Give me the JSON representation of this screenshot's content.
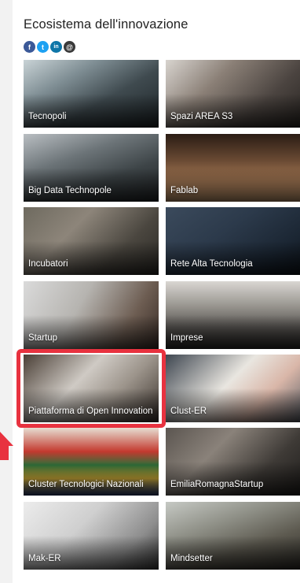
{
  "section": {
    "title": "Ecosistema dell'innovazione"
  },
  "social": [
    {
      "icon": "facebook-icon",
      "color": "#3b5998",
      "glyph": "f"
    },
    {
      "icon": "twitter-icon",
      "color": "#1da1f2",
      "glyph": "t"
    },
    {
      "icon": "linkedin-icon",
      "color": "#0e76a8",
      "glyph": "in"
    },
    {
      "icon": "email-icon",
      "color": "#3a3a3a",
      "glyph": "@"
    }
  ],
  "highlight_color": "#e8323f",
  "tiles": [
    {
      "label": "Tecnopoli",
      "name": "tile-tecnopoli",
      "bg": "linear-gradient(150deg,#c9d3d6 0%,#7f8e94 30%,#3f4a4f 60%,#1e2528 100%)"
    },
    {
      "label": "Spazi AREA S3",
      "name": "tile-spazi-area-s3",
      "bg": "linear-gradient(135deg,#d8d4cf 0%,#8a7f76 35%,#4b4440 70%,#2a2623 100%)"
    },
    {
      "label": "Big Data Technopole",
      "name": "tile-big-data-technopole",
      "bg": "linear-gradient(160deg,#b9bec2 0%,#6c7478 35%,#3d4447 65%,#232628 100%)"
    },
    {
      "label": "Fablab",
      "name": "tile-fablab",
      "bg": "linear-gradient(180deg,#2a1c14 0%,#6b4b34 40%,#a77a55 70%,#c99c70 100%)"
    },
    {
      "label": "Incubatori",
      "name": "tile-incubatori",
      "bg": "linear-gradient(135deg,#6e6a5f 0%,#8d857a 35%,#4a463f 70%,#2c2a26 100%)"
    },
    {
      "label": "Rete Alta Tecnologia",
      "name": "tile-rete-alta-tecnologia",
      "bg": "linear-gradient(145deg,#3b4a5c 0%,#2c3a4b 40%,#1b2633 75%,#0e141b 100%)"
    },
    {
      "label": "Startup",
      "name": "tile-startup",
      "bg": "linear-gradient(120deg,#dadada 0%,#b6b4b0 40%,#6d5d52 75%,#3a2e28 100%)"
    },
    {
      "label": "Imprese",
      "name": "tile-imprese",
      "bg": "linear-gradient(180deg,#d9d6d2 0%,#9b9892 35%,#55524f 70%,#2d2b29 100%)"
    },
    {
      "label": "Piattaforma di Open Innovation",
      "name": "tile-piattaforma-open-innovation",
      "bg": "linear-gradient(135deg,#4a3f36 0%,#cfcac4 40%,#9c948b 65%,#3a322c 100%)"
    },
    {
      "label": "Clust-ER",
      "name": "tile-clust-er",
      "bg": "linear-gradient(135deg,#3e4650 0%,#e9e6e0 45%,#d9b6a8 70%,#5b5f66 100%)"
    },
    {
      "label": "Cluster Tecnologici Nazionali",
      "name": "tile-cluster-tecnologici-nazionali",
      "bg": "linear-gradient(180deg,#e6ded2 0%,#c43a2f 35%,#2f6f3a 55%,#d6b23a 75%,#2c3f7a 100%)"
    },
    {
      "label": "EmiliaRomagnaStartup",
      "name": "tile-emiliaromagnastartup",
      "bg": "linear-gradient(135deg,#5b5550 0%,#8a827a 35%,#3e3a36 70%,#201e1c 100%)"
    },
    {
      "label": "Mak-ER",
      "name": "tile-mak-er",
      "bg": "linear-gradient(135deg,#ececec 0%,#cfcfcf 40%,#8d8d8d 75%,#3c3c3c 100%)"
    },
    {
      "label": "Mindsetter",
      "name": "tile-mindsetter",
      "bg": "linear-gradient(160deg,#c6c9c4 0%,#8e8f86 35%,#5d5a50 65%,#2f2d28 100%)"
    }
  ]
}
